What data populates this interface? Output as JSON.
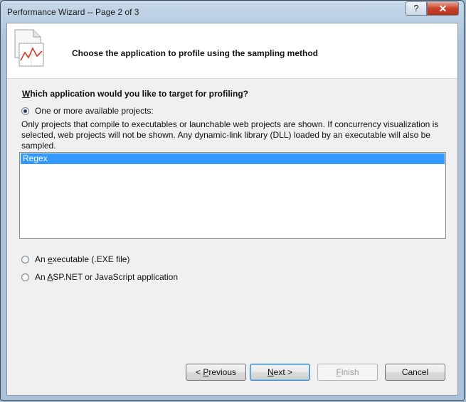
{
  "window": {
    "title": "Performance Wizard -- Page 2 of 3",
    "help_label": "?",
    "close_label": "✕"
  },
  "header": {
    "title": "Choose the application to profile using the sampling method"
  },
  "main": {
    "question_prefix": "W",
    "question_rest": "hich application would you like to target for profiling?",
    "options": [
      {
        "label": "One or more available projects:",
        "checked": true
      },
      {
        "label_pre": "An ",
        "label_key": "e",
        "label_post": "xecutable (.EXE file)",
        "checked": false
      },
      {
        "label_pre": "An ",
        "label_key": "A",
        "label_post": "SP.NET or JavaScript application",
        "checked": false
      }
    ],
    "description": "Only projects that compile to executables or launchable web projects are shown. If concurrency visualization is selected, web projects will not be shown. Any dynamic-link library (DLL) loaded by an executable will also be sampled.",
    "projects": [
      "Regex"
    ]
  },
  "buttons": {
    "previous_pre": "< ",
    "previous_key": "P",
    "previous_post": "revious",
    "next_key": "N",
    "next_post": "ext >",
    "finish_key": "F",
    "finish_post": "inish",
    "cancel": "Cancel"
  },
  "colors": {
    "selection": "#3399ff",
    "close_button": "#c8432b"
  }
}
